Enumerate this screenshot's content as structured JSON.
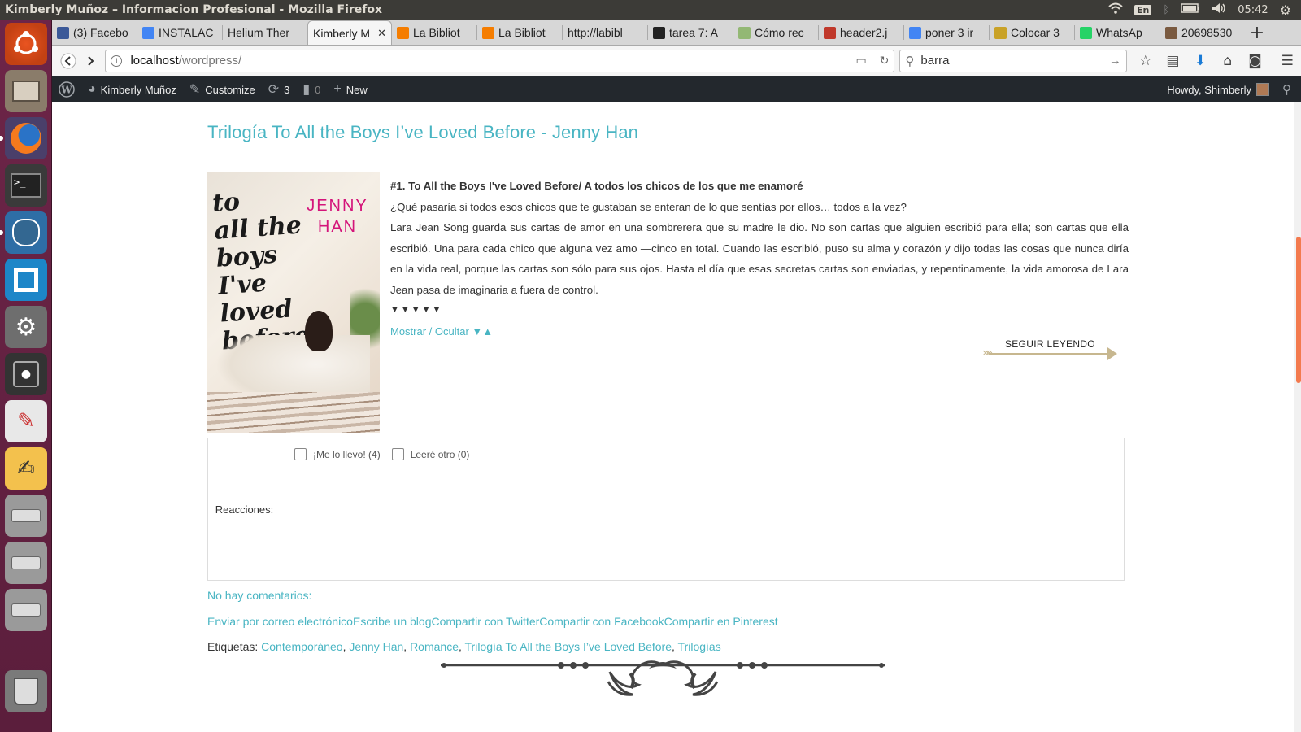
{
  "window": {
    "title": "Kimberly Muñoz – Informacion Profesional - Mozilla Firefox"
  },
  "panel": {
    "keyboard_layout": "En",
    "time": "05:42"
  },
  "launcher": {
    "items": [
      "ubuntu-dash",
      "files",
      "firefox",
      "terminal",
      "pgadmin",
      "app-square",
      "system-settings",
      "safe",
      "evince",
      "text-editor",
      "drive-1",
      "drive-2",
      "drive-3",
      "trash"
    ]
  },
  "tabs": [
    {
      "label": "(3) Facebo",
      "icon": "facebook-icon",
      "color": "#3b5998"
    },
    {
      "label": "INSTALAC",
      "icon": "google-docs-icon",
      "color": "#4285f4"
    },
    {
      "label": "Helium Ther",
      "icon": "none",
      "color": "#d7d7d7"
    },
    {
      "label": "Kimberly M",
      "icon": "none",
      "color": "#f5f5f5",
      "active": true
    },
    {
      "label": "La Bibliot",
      "icon": "blogger-icon",
      "color": "#f57d00"
    },
    {
      "label": "La Bibliot",
      "icon": "blogger-icon",
      "color": "#f57d00"
    },
    {
      "label": "http://labibl",
      "icon": "none",
      "color": "#d7d7d7"
    },
    {
      "label": "tarea 7: A",
      "icon": "panda-icon",
      "color": "#222222"
    },
    {
      "label": "Cómo rec",
      "icon": "wikihow-icon",
      "color": "#93b874"
    },
    {
      "label": "header2.j",
      "icon": "image-icon",
      "color": "#c0392b"
    },
    {
      "label": "poner 3 ir",
      "icon": "google-icon",
      "color": "#4285f4"
    },
    {
      "label": "Colocar 3",
      "icon": "site-icon",
      "color": "#c9a227"
    },
    {
      "label": "WhatsAp",
      "icon": "whatsapp-icon",
      "color": "#25d366"
    },
    {
      "label": "20698530",
      "icon": "image-icon",
      "color": "#7a5a40"
    }
  ],
  "navbar": {
    "url_host": "localhost",
    "url_path": "/wordpress/",
    "search_value": "barra"
  },
  "adminbar": {
    "site_name": "Kimberly Muñoz",
    "customize": "Customize",
    "updates_count": "3",
    "comments_count": "0",
    "new": "New",
    "howdy": "Howdy, Shimberly"
  },
  "post": {
    "title": "Trilogía To All the Boys I’ve Loved Before - Jenny Han",
    "cover": {
      "hand_lines": [
        "to",
        "all the",
        "boys",
        "I've",
        "loved",
        "before"
      ],
      "author": "JENNY HAN"
    },
    "heading": "#1. To All the Boys I've Loved Before/ A todos los chicos de los que me enamoré",
    "question": "¿Qué pasaría si todos esos chicos que te gustaban se enteran de lo que sentías por ellos… todos a la vez?",
    "summary": "Lara Jean Song guarda sus cartas de amor en una sombrerera que su madre le dio. No son cartas que alguien escribió para ella; son cartas que ella escribió. Una para cada chico que alguna vez amo —cinco en total. Cuando las escribió, puso su alma y corazón y dijo todas las cosas que nunca diría en la vida real, porque las cartas son sólo para sus ojos. Hasta el día que esas secretas cartas son enviadas, y repentinamente, la vida amorosa de Lara Jean pasa de imaginaria a fuera de control.",
    "arrows": "▼▼▼▼▼",
    "toggle_label": "Mostrar / Ocultar ▼▲",
    "read_more": "SEGUIR LEYENDO"
  },
  "reactions": {
    "label": "Reacciones:",
    "options": [
      {
        "label": "¡Me lo llevo! (4)",
        "checked": false
      },
      {
        "label": "Leeré otro (0)",
        "checked": false
      }
    ]
  },
  "comments": "No hay comentarios:",
  "share": [
    "Enviar por correo electrónico",
    "Escribe un blog",
    "Compartir con Twitter",
    "Compartir con Facebook",
    "Compartir en Pinterest"
  ],
  "tags": {
    "label": "Etiquetas:",
    "items": [
      "Contemporáneo",
      "Jenny Han",
      "Romance",
      "Trilogía To All the Boys I’ve Loved Before",
      "Trilogías"
    ]
  },
  "colors": {
    "accent": "#49b5c3",
    "adminbar": "#23282d",
    "launcher": "#5b1e3c",
    "panel": "#3c3b37"
  }
}
